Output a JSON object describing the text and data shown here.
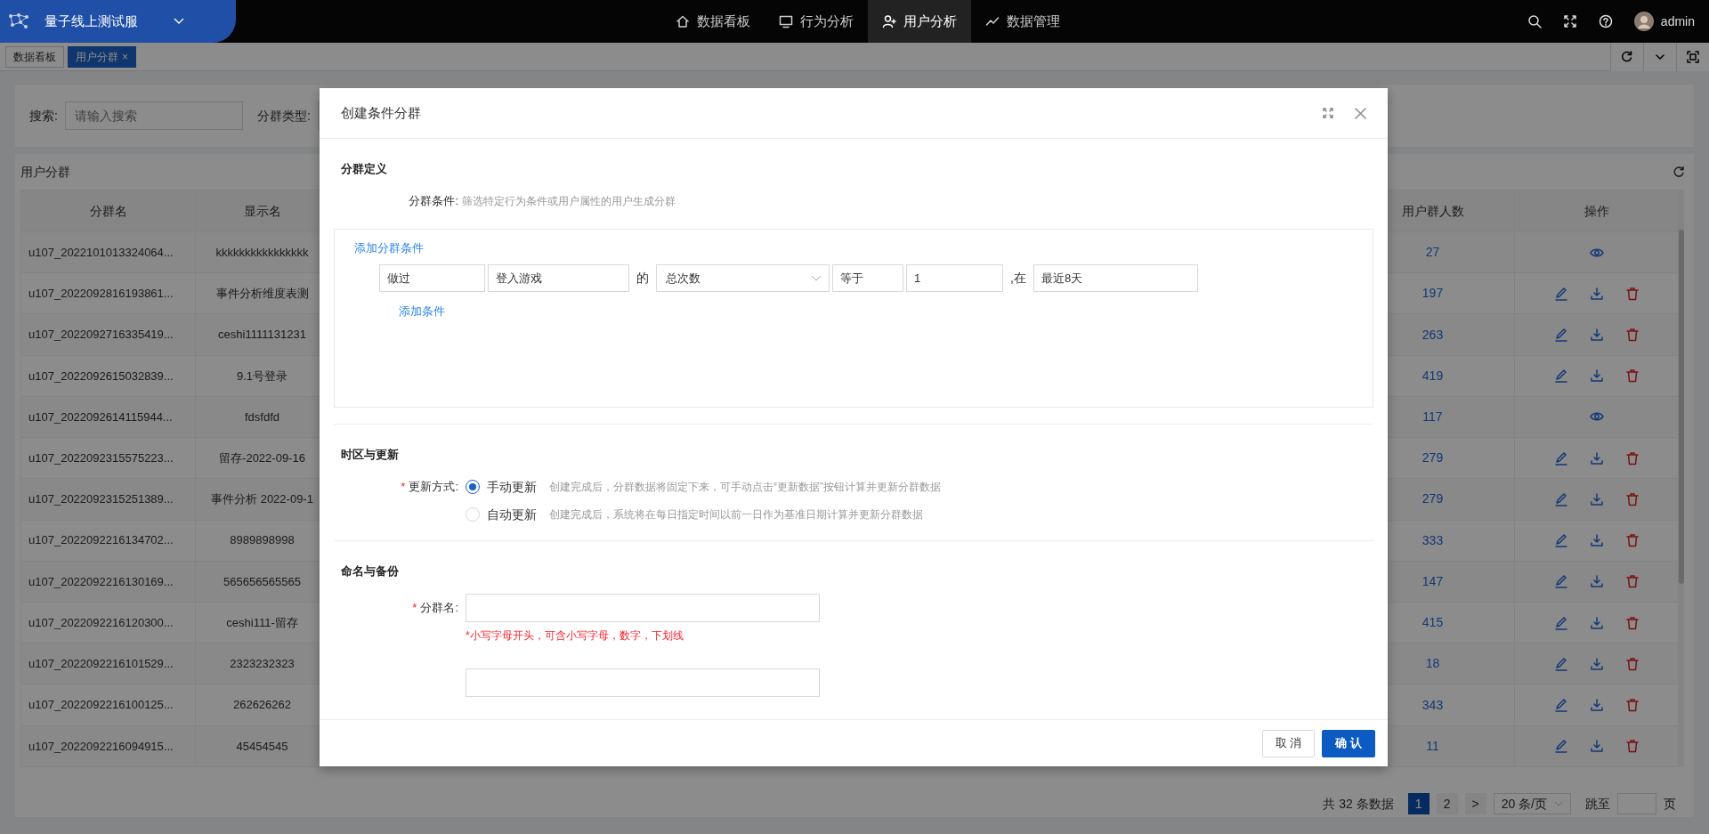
{
  "top_bar": {
    "brand": "量子线上测试服",
    "nav": [
      {
        "label": "数据看板",
        "selected": false
      },
      {
        "label": "行为分析",
        "selected": false
      },
      {
        "label": "用户分析",
        "selected": true
      },
      {
        "label": "数据管理",
        "selected": false
      }
    ],
    "user": "admin"
  },
  "tab_bar": {
    "tabs": [
      {
        "label": "数据看板",
        "selected": false
      },
      {
        "label": "用户分群",
        "selected": true,
        "close": "×"
      }
    ]
  },
  "search": {
    "label": "搜索:",
    "placeholder": "请输入搜索",
    "type_label": "分群类型:"
  },
  "table": {
    "title": "用户分群",
    "columns": [
      "分群名",
      "显示名",
      "用户群人数",
      "操作"
    ],
    "rows": [
      {
        "name": "u107_2022101013324064...",
        "display": "kkkkkkkkkkkkkkkk",
        "count": "27",
        "kind": "view"
      },
      {
        "name": "u107_2022092816193861...",
        "display": "事件分析维度表测",
        "count": "197",
        "kind": "manage"
      },
      {
        "name": "u107_2022092716335419...",
        "display": "ceshi1111131231",
        "count": "263",
        "kind": "manage"
      },
      {
        "name": "u107_2022092615032839...",
        "display": "9.1号登录",
        "count": "419",
        "kind": "manage"
      },
      {
        "name": "u107_2022092614115944...",
        "display": "fdsfdfd",
        "count": "117",
        "kind": "view"
      },
      {
        "name": "u107_2022092315575223...",
        "display": "留存-2022-09-16",
        "count": "279",
        "kind": "manage"
      },
      {
        "name": "u107_2022092315251389...",
        "display": "事件分析 2022-09-1",
        "count": "279",
        "kind": "manage"
      },
      {
        "name": "u107_2022092216134702...",
        "display": "8989898998",
        "count": "333",
        "kind": "manage"
      },
      {
        "name": "u107_2022092216130169...",
        "display": "565656565565",
        "count": "147",
        "kind": "manage"
      },
      {
        "name": "u107_2022092216120300...",
        "display": "ceshi111-留存",
        "count": "415",
        "kind": "manage"
      },
      {
        "name": "u107_2022092216101529...",
        "display": "2323232323",
        "count": "18",
        "kind": "manage"
      },
      {
        "name": "u107_2022092216100125...",
        "display": "262626262",
        "count": "343",
        "kind": "manage"
      },
      {
        "name": "u107_2022092216094915...",
        "display": "45454545",
        "count": "11",
        "kind": "manage"
      }
    ]
  },
  "pagination": {
    "total": "共 32 条数据",
    "pages": [
      {
        "label": "1",
        "selected": true
      },
      {
        "label": "2",
        "selected": false
      }
    ],
    "next": ">",
    "page_size": "20 条/页",
    "jump_label": "跳至",
    "page_unit": "页"
  },
  "modal": {
    "title": "创建条件分群",
    "sections": [
      {
        "kind": "definition",
        "title": "分群定义",
        "label": "分群条件:",
        "hint": "筛选特定行为条件或用户属性的用户生成分群",
        "add_group": "添加分群条件",
        "condition": [
          {
            "kind": "box",
            "text": "做过"
          },
          {
            "kind": "field",
            "text": "登入游戏"
          },
          {
            "kind": "word",
            "text": "的"
          },
          {
            "kind": "select",
            "text": "总次数"
          },
          {
            "kind": "box",
            "text": "等于"
          },
          {
            "kind": "field",
            "text": "1"
          },
          {
            "kind": "word",
            "text": ",在"
          },
          {
            "kind": "box",
            "text": "最近8天"
          }
        ],
        "add_condition": "添加条件"
      },
      {
        "kind": "update",
        "title": "时区与更新",
        "label": "更新方式:",
        "required_mark": "*",
        "options": [
          {
            "label": "手动更新",
            "hint": "创建完成后，分群数据将固定下来，可手动点击“更新数据”按钮计算并更新分群数据",
            "selected": true
          },
          {
            "label": "自动更新",
            "hint": "创建完成后，系统将在每日指定时间以前一日作为基准日期计算并更新分群数据",
            "selected": false
          }
        ]
      },
      {
        "kind": "naming",
        "title": "命名与备份",
        "fields": [
          {
            "label": "分群名:",
            "required_mark": "*",
            "error": "*小写字母开头，可含小写字母，数字，下划线"
          }
        ]
      }
    ],
    "buttons": [
      {
        "label": "取 消",
        "kind": "default"
      },
      {
        "label": "确 认",
        "kind": "primary"
      }
    ]
  }
}
